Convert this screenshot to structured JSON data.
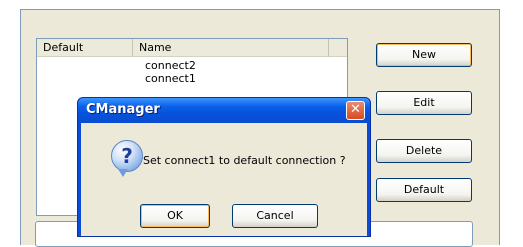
{
  "list": {
    "columns": [
      "Default",
      "Name"
    ],
    "rows": [
      {
        "default": "",
        "name": "connect2"
      },
      {
        "default": "",
        "name": "connect1"
      }
    ]
  },
  "buttons": {
    "new": "New",
    "edit": "Edit",
    "delete": "Delete",
    "default": "Default"
  },
  "dialog": {
    "title": "CManager",
    "message": "Set connect1 to default connection ?",
    "ok": "OK",
    "cancel": "Cancel",
    "icon": "question-icon",
    "close_glyph": "✕"
  },
  "colors": {
    "titlebar": "#0a5fe8",
    "close_button": "#d44b22",
    "face": "#ece9d8"
  }
}
